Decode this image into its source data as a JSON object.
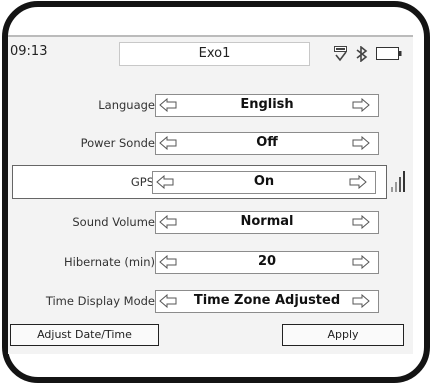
{
  "status": {
    "time": "09:13",
    "title": "Exo1",
    "icons": [
      "data-transfer-icon",
      "bluetooth-icon",
      "battery-icon"
    ]
  },
  "settings": [
    {
      "label": "Language",
      "value": "English"
    },
    {
      "label": "Power Sonde",
      "value": "Off"
    },
    {
      "label": "GPS",
      "value": "On",
      "selected": true
    },
    {
      "label": "Sound Volume",
      "value": "Normal"
    },
    {
      "label": "Hibernate (min)",
      "value": "20"
    },
    {
      "label": "Time Display Mode",
      "value": "Time Zone Adjusted"
    }
  ],
  "buttons": {
    "adjust_date_time": "Adjust Date/Time",
    "apply": "Apply"
  },
  "colors": {
    "frame": "#141414",
    "screen_bg": "#f3f3f3"
  }
}
